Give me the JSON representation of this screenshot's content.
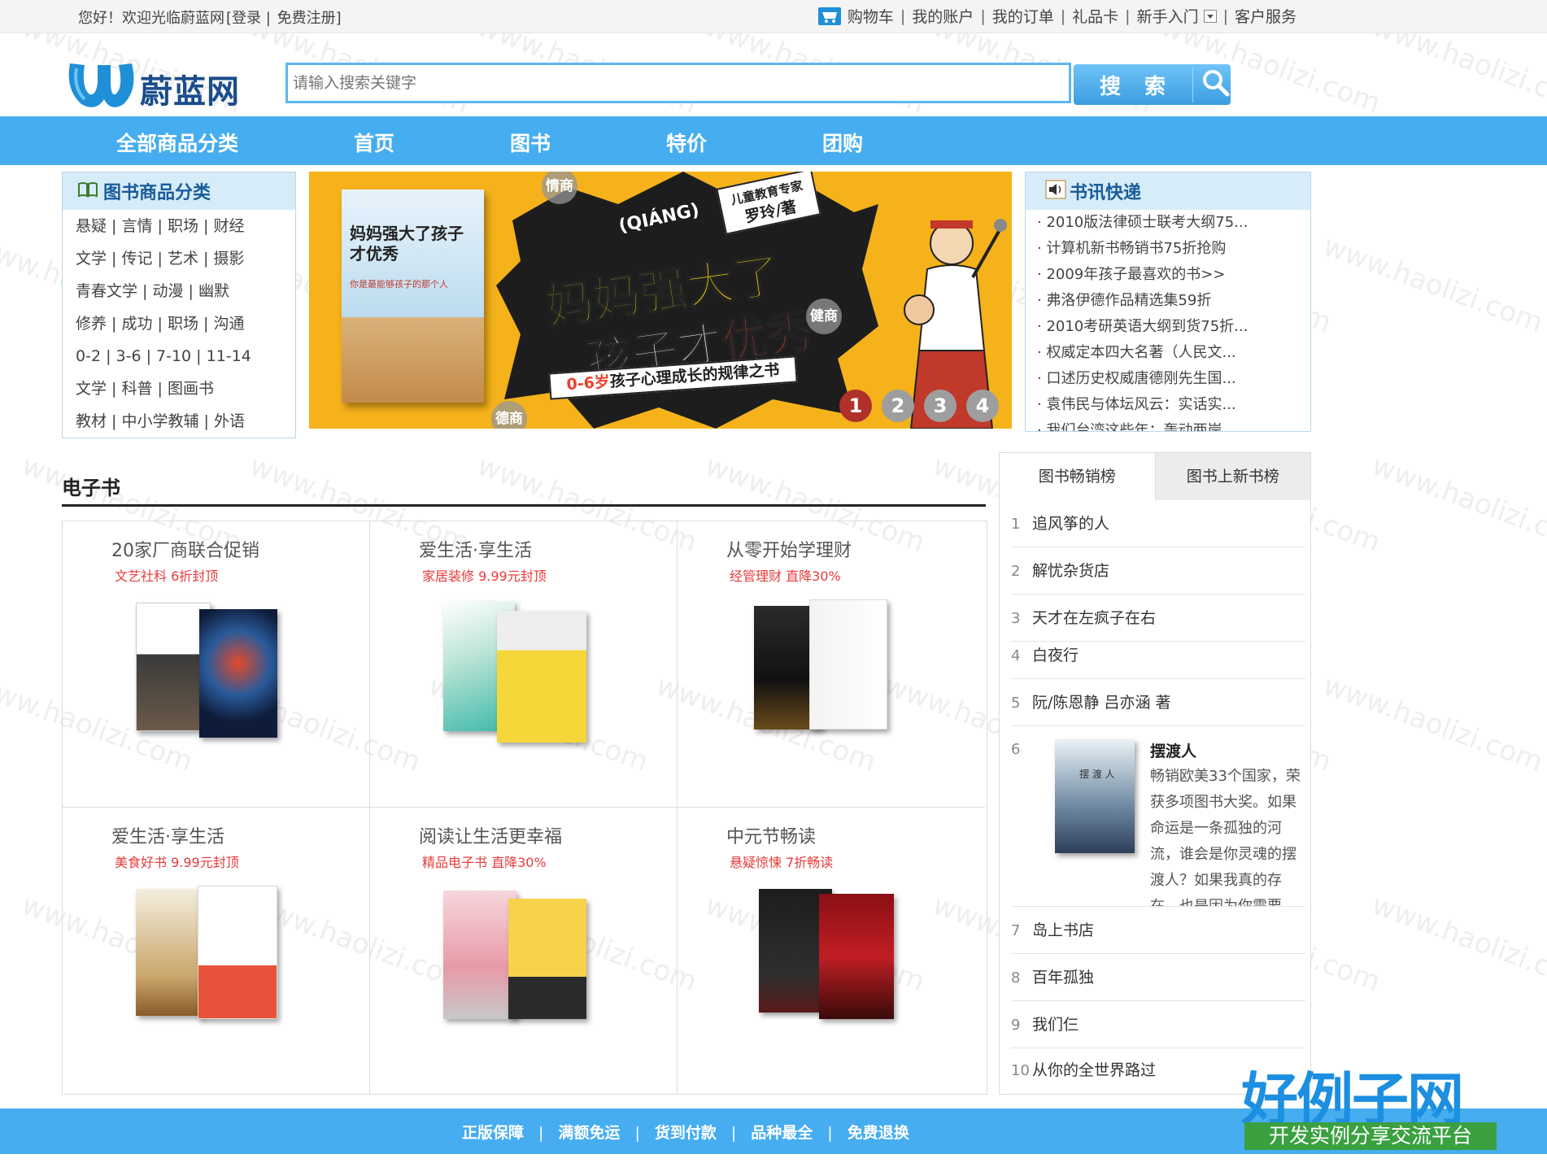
{
  "topbar": {
    "welcome": "您好！欢迎光临蔚蓝网",
    "login": "[登录",
    "sep": "|",
    "register": "免费注册]",
    "links": [
      "购物车",
      "我的账户",
      "我的订单",
      "礼品卡",
      "新手入门",
      "客户服务"
    ]
  },
  "header": {
    "logo_text": "蔚蓝网",
    "search_placeholder": "请输入搜索关键字",
    "search_button": "搜 索"
  },
  "nav": {
    "items": [
      "全部商品分类",
      "首页",
      "图书",
      "特价",
      "团购"
    ]
  },
  "categories": {
    "title": "图书商品分类",
    "rows": [
      "悬疑 | 言情 | 职场 | 财经",
      "文学 | 传记 | 艺术 | 摄影",
      "青春文学 | 动漫 | 幽默",
      "修养 | 成功 | 职场 | 沟通",
      "0-2 | 3-6 | 7-10 | 11-14",
      "文学 | 科普 | 图画书",
      "教材 | 中小学教辅 | 外语"
    ]
  },
  "banner": {
    "book_title": "妈妈强大了孩子才优秀",
    "book_sub": "你是最能够孩子的那个人",
    "pinyin": "(QIÁNG)",
    "headline1": "妈妈强大了",
    "headline2a": "孩子才",
    "headline2b": "优秀",
    "subline_a": "0-6岁",
    "subline_b": "孩子心理成长的规律之书",
    "author_line1": "儿童教育专家",
    "author_line2": "罗玲/著",
    "wm1": "情商",
    "wm2": "健商",
    "wm3": "德商",
    "dots": [
      "1",
      "2",
      "3",
      "4"
    ],
    "active_dot": 1
  },
  "news": {
    "title": "书讯快递",
    "items": [
      "2010版法律硕士联考大纲75...",
      "计算机新书畅销书75折抢购",
      "2009年孩子最喜欢的书>>",
      "弗洛伊德作品精选集59折",
      "2010考研英语大纲到货75折...",
      "权威定本四大名著（人民文...",
      "口述历史权威唐德刚先生国...",
      "袁伟民与体坛风云：实话实...",
      "我们台湾这些年：轰动两岸"
    ]
  },
  "ebook": {
    "title": "电子书",
    "cells": [
      {
        "title": "20家厂商联合促销",
        "sub": "文艺社科 6折封顶"
      },
      {
        "title": "爱生活·享生活",
        "sub": "家居装修 9.99元封顶"
      },
      {
        "title": "从零开始学理财",
        "sub": "经管理财 直降30%"
      },
      {
        "title": "爱生活·享生活",
        "sub": "美食好书 9.99元封顶"
      },
      {
        "title": "阅读让生活更幸福",
        "sub": "精品电子书 直降30%"
      },
      {
        "title": "中元节畅读",
        "sub": "悬疑惊悚 7折畅读"
      }
    ]
  },
  "bestseller": {
    "tabs": [
      "图书畅销榜",
      "图书上新书榜"
    ],
    "items": [
      {
        "n": "1",
        "name": "追风筝的人"
      },
      {
        "n": "2",
        "name": "解忧杂货店"
      },
      {
        "n": "3",
        "name": "天才在左疯子在右"
      },
      {
        "n": "4",
        "name": "白夜行"
      },
      {
        "n": "5",
        "name": "阮/陈恩静 吕亦涵 著"
      },
      {
        "n": "7",
        "name": "岛上书店"
      },
      {
        "n": "8",
        "name": "百年孤独"
      },
      {
        "n": "9",
        "name": "我们仨"
      },
      {
        "n": "10",
        "name": "从你的全世界路过"
      }
    ],
    "featured": {
      "n": "6",
      "name": "摆渡人",
      "cover_text": "摆 渡 人",
      "desc": "畅销欧美33个国家，荣获多项图书大奖。如果命运是一条孤独的河流，谁会是你灵魂的摆渡人？如果我真的存在，也是因为你需要"
    }
  },
  "footer": {
    "items": [
      "正版保障",
      "满额免运",
      "货到付款",
      "品种最全",
      "免费退换"
    ]
  },
  "site_mark": {
    "big": "好例子网",
    "small": "开发实例分享交流平台"
  },
  "watermark": "www.haolizi.com",
  "colors": {
    "nav_blue": "#45adf0",
    "search_border": "#5db7ef",
    "promo_red": "#e83a3a",
    "panel_header": "#d6ecf9"
  }
}
